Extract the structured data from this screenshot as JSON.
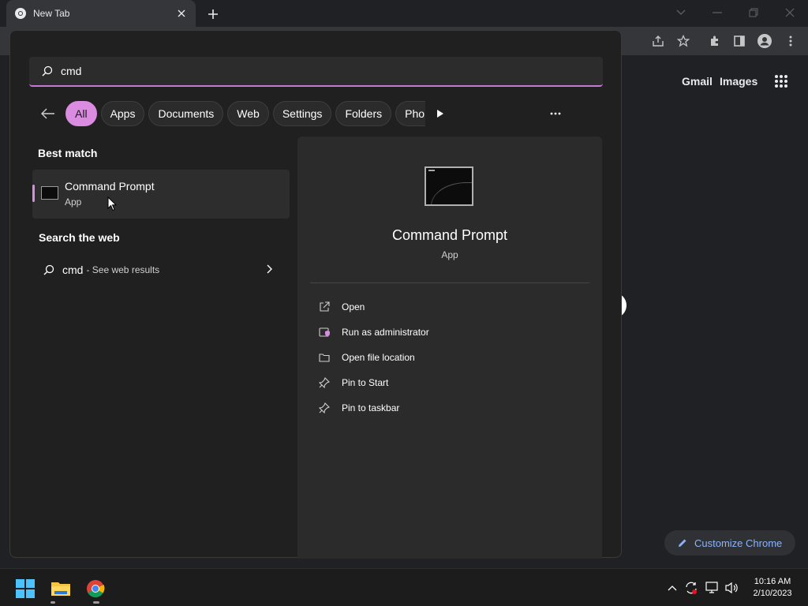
{
  "browser": {
    "tab_title": "New Tab",
    "links": {
      "gmail": "Gmail",
      "images": "Images"
    },
    "customize_label": "Customize Chrome"
  },
  "search": {
    "query": "cmd"
  },
  "filters": {
    "items": [
      "All",
      "Apps",
      "Documents",
      "Web",
      "Settings",
      "Folders",
      "Pho"
    ]
  },
  "results": {
    "best_match_heading": "Best match",
    "best_match": {
      "name": "Command Prompt",
      "type": "App"
    },
    "web_heading": "Search the web",
    "web_result": {
      "query": "cmd",
      "suffix": "- See web results"
    }
  },
  "detail": {
    "title": "Command Prompt",
    "type": "App",
    "actions": [
      {
        "label": "Open",
        "icon": "open-external-icon"
      },
      {
        "label": "Run as administrator",
        "icon": "shield-icon"
      },
      {
        "label": "Open file location",
        "icon": "folder-icon"
      },
      {
        "label": "Pin to Start",
        "icon": "pin-icon"
      },
      {
        "label": "Pin to taskbar",
        "icon": "pin-icon"
      }
    ]
  },
  "taskbar": {
    "time": "10:16 AM",
    "date": "2/10/2023"
  },
  "colors": {
    "accent": "#d98ce0",
    "panel": "#202020",
    "chrome_link": "#8ab4f8"
  }
}
